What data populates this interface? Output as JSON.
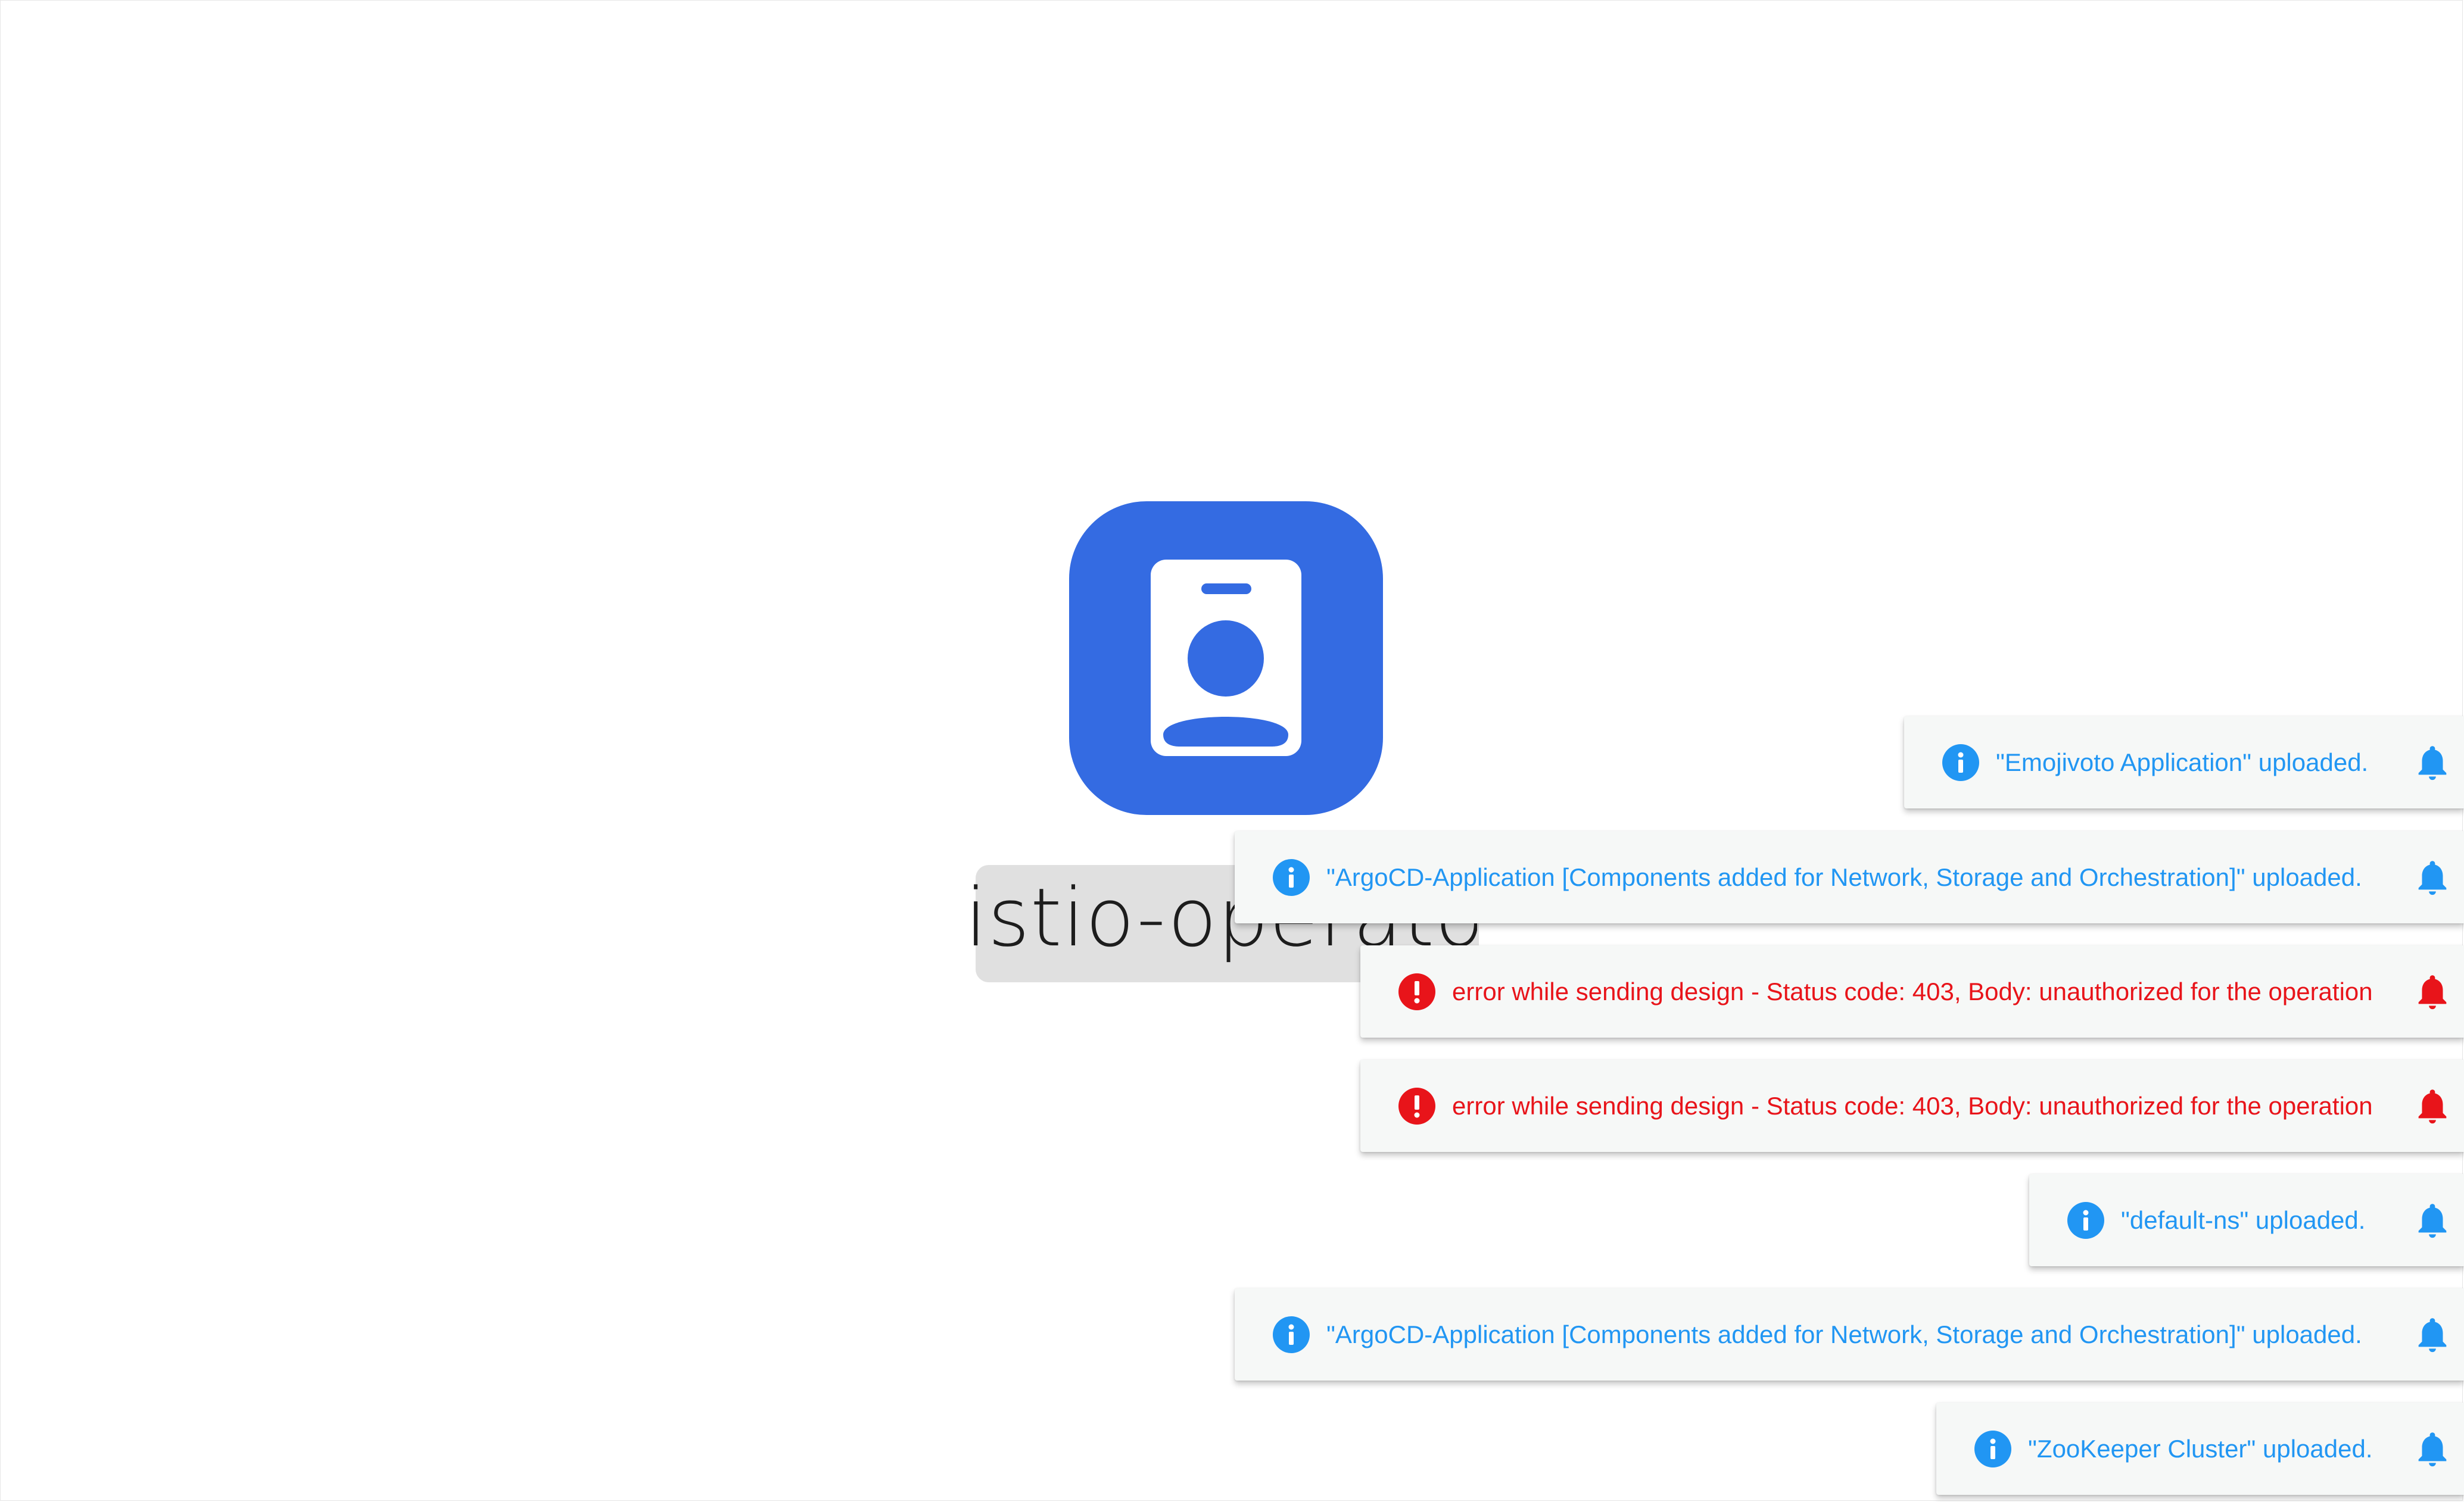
{
  "design": {
    "name": "istio-operator",
    "icon": "id-badge-icon",
    "icon_color": "#346be2"
  },
  "colors": {
    "info": "#2196f3",
    "error": "#e8141a",
    "toast_bg": "#f6f8f7"
  },
  "notifications": [
    {
      "type": "info",
      "icon": "info-icon",
      "message": "\"Emojivoto Application\" uploaded."
    },
    {
      "type": "info",
      "icon": "info-icon",
      "message": "\"ArgoCD-Application [Components added for Network, Storage and Orchestration]\" uploaded."
    },
    {
      "type": "error",
      "icon": "error-icon",
      "message": "error while sending design - Status code: 403, Body: unauthorized for the operation"
    },
    {
      "type": "error",
      "icon": "error-icon",
      "message": "error while sending design - Status code: 403, Body: unauthorized for the operation"
    },
    {
      "type": "info",
      "icon": "info-icon",
      "message": "\"default-ns\" uploaded."
    },
    {
      "type": "info",
      "icon": "info-icon",
      "message": "\"ArgoCD-Application [Components added for Network, Storage and Orchestration]\" uploaded."
    },
    {
      "type": "info",
      "icon": "info-icon",
      "message": "\"ZooKeeper Cluster\" uploaded."
    }
  ]
}
